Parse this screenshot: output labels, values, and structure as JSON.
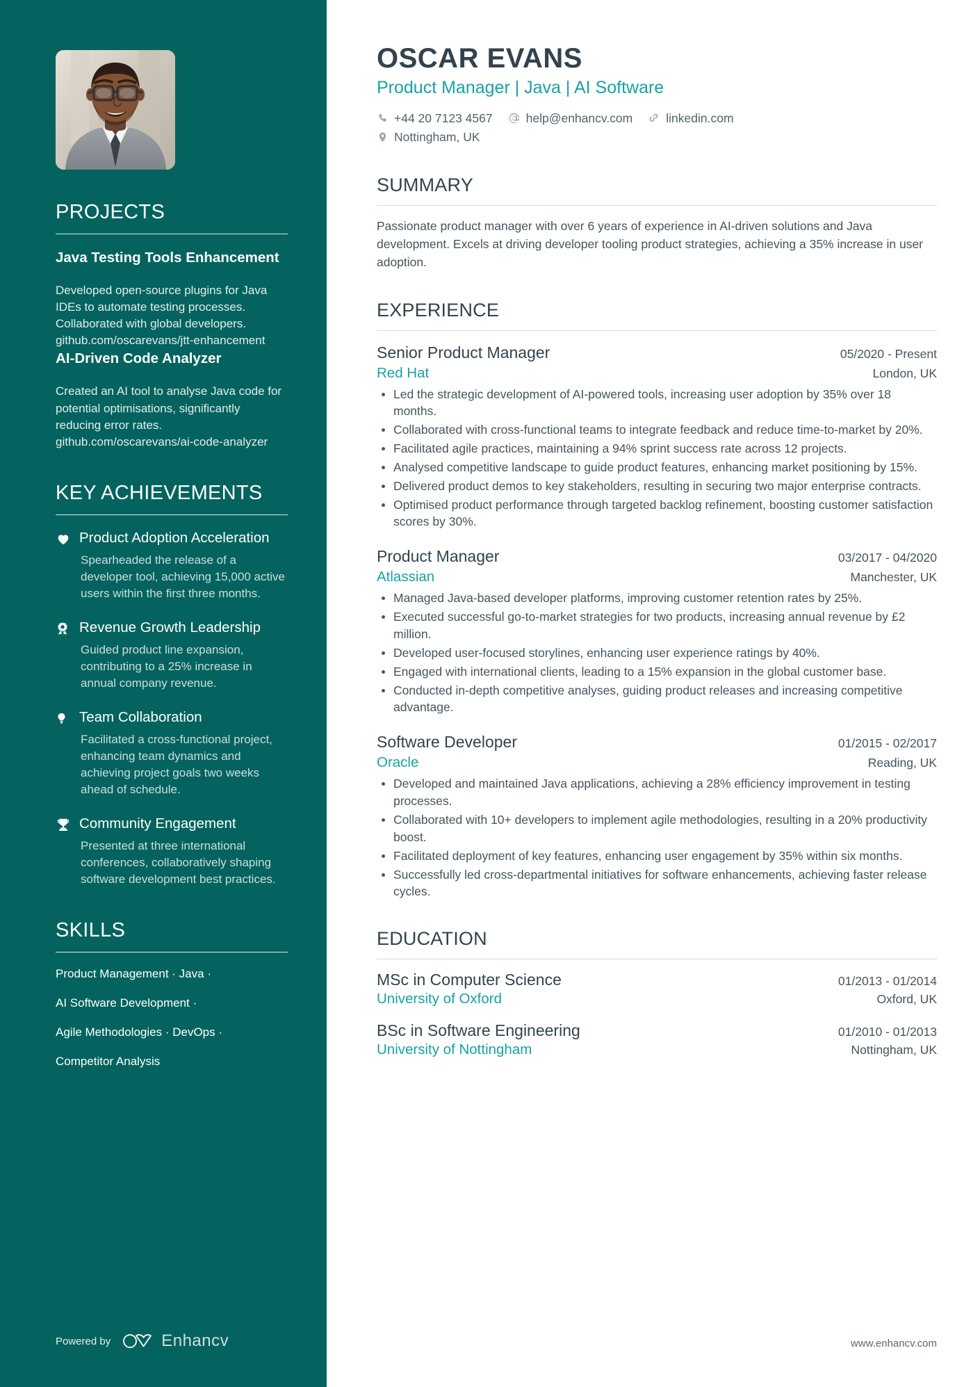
{
  "colors": {
    "sidebar_bg": "#04635E",
    "accent_teal": "#17A3A7",
    "heading_dark": "#33434D",
    "body_text": "#46545D"
  },
  "header": {
    "name": "OSCAR EVANS",
    "role": "Product Manager | Java | AI Software",
    "contacts": [
      {
        "icon": "phone-icon",
        "value": "+44 20 7123 4567"
      },
      {
        "icon": "email-icon",
        "value": "help@enhancv.com"
      },
      {
        "icon": "link-icon",
        "value": "linkedin.com"
      },
      {
        "icon": "location-icon",
        "value": "Nottingham, UK"
      }
    ]
  },
  "sidebar": {
    "projects": {
      "title": "PROJECTS",
      "items": [
        {
          "name": "Java Testing Tools Enhancement",
          "description": "Developed open-source plugins for Java IDEs to automate testing processes. Collaborated with global developers. github.com/oscarevans/jtt-enhancement"
        },
        {
          "name": "AI-Driven Code Analyzer",
          "description": "Created an AI tool to analyse Java code for potential optimisations, significantly reducing error rates. github.com/oscarevans/ai-code-analyzer"
        }
      ]
    },
    "key_achievements": {
      "title": "KEY ACHIEVEMENTS",
      "items": [
        {
          "icon": "heart-icon",
          "title": "Product Adoption Acceleration",
          "description": "Spearheaded the release of a developer tool, achieving 15,000 active users within the first three months."
        },
        {
          "icon": "award-ribbon-icon",
          "title": "Revenue Growth Leadership",
          "description": "Guided product line expansion, contributing to a 25% increase in annual company revenue."
        },
        {
          "icon": "lightbulb-icon",
          "title": "Team Collaboration",
          "description": "Facilitated a cross-functional project, enhancing team dynamics and achieving project goals two weeks ahead of schedule."
        },
        {
          "icon": "trophy-icon",
          "title": "Community Engagement",
          "description": "Presented at three international conferences, collaboratively shaping software development best practices."
        }
      ]
    },
    "skills": {
      "title": "SKILLS",
      "lines": [
        "Product Management · Java ·",
        "AI Software Development ·",
        "Agile Methodologies · DevOps ·",
        "Competitor Analysis"
      ]
    },
    "footer": {
      "powered_by": "Powered by",
      "brand": "Enhancv"
    }
  },
  "main": {
    "summary": {
      "title": "SUMMARY",
      "text": "Passionate product manager with over 6 years of experience in AI-driven solutions and Java development. Excels at driving developer tooling product strategies, achieving a 35% increase in user adoption."
    },
    "experience": {
      "title": "EXPERIENCE",
      "jobs": [
        {
          "title": "Senior Product Manager",
          "date": "05/2020 - Present",
          "company": "Red Hat",
          "location": "London, UK",
          "bullets": [
            "Led the strategic development of AI-powered tools, increasing user adoption by 35% over 18 months.",
            "Collaborated with cross-functional teams to integrate feedback and reduce time-to-market by 20%.",
            "Facilitated agile practices, maintaining a 94% sprint success rate across 12 projects.",
            "Analysed competitive landscape to guide product features, enhancing market positioning by 15%.",
            "Delivered product demos to key stakeholders, resulting in securing two major enterprise contracts.",
            "Optimised product performance through targeted backlog refinement, boosting customer satisfaction scores by 30%."
          ]
        },
        {
          "title": "Product Manager",
          "date": "03/2017 - 04/2020",
          "company": "Atlassian",
          "location": "Manchester, UK",
          "bullets": [
            "Managed Java-based developer platforms, improving customer retention rates by 25%.",
            "Executed successful go-to-market strategies for two products, increasing annual revenue by £2 million.",
            "Developed user-focused storylines, enhancing user experience ratings by 40%.",
            "Engaged with international clients, leading to a 15% expansion in the global customer base.",
            "Conducted in-depth competitive analyses, guiding product releases and increasing competitive advantage."
          ]
        },
        {
          "title": "Software Developer",
          "date": "01/2015 - 02/2017",
          "company": "Oracle",
          "location": "Reading, UK",
          "bullets": [
            "Developed and maintained Java applications, achieving a 28% efficiency improvement in testing processes.",
            "Collaborated with 10+ developers to implement agile methodologies, resulting in a 20% productivity boost.",
            "Facilitated deployment of key features, enhancing user engagement by 35% within six months.",
            "Successfully led cross-departmental initiatives for software enhancements, achieving faster release cycles."
          ]
        }
      ]
    },
    "education": {
      "title": "EDUCATION",
      "entries": [
        {
          "degree": "MSc in Computer Science",
          "date": "01/2013 - 01/2014",
          "school": "University of Oxford",
          "location": "Oxford, UK"
        },
        {
          "degree": "BSc in Software Engineering",
          "date": "01/2010 - 01/2013",
          "school": "University of Nottingham",
          "location": "Nottingham, UK"
        }
      ]
    },
    "footer": {
      "website": "www.enhancv.com"
    }
  }
}
